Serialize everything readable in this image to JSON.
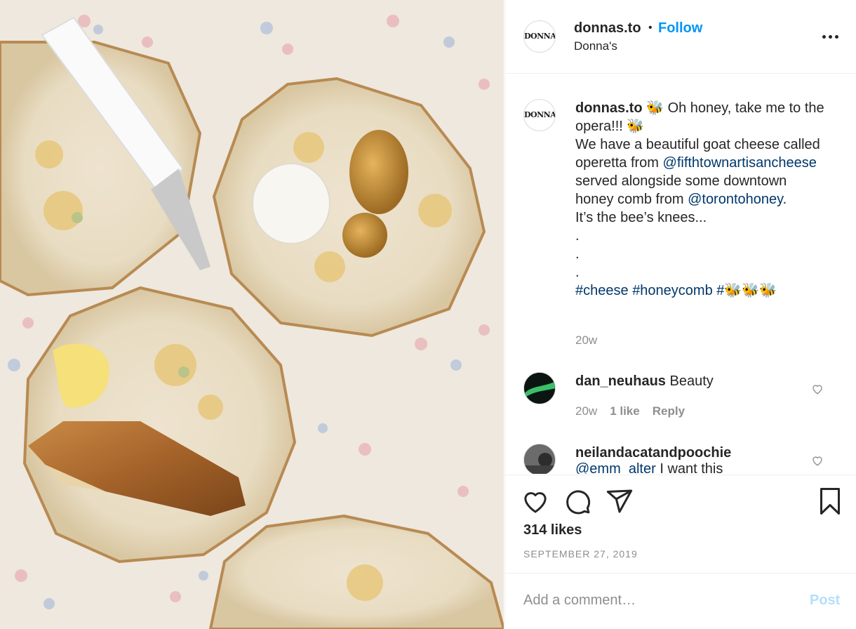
{
  "photo": {
    "description_icon": "food-photo"
  },
  "header": {
    "avatar_text": "DONNA'S",
    "username": "donnas.to",
    "separator": "•",
    "follow_label": "Follow",
    "subtitle": "Donna's",
    "more_icon": "more-options-icon"
  },
  "caption": {
    "username": "donnas.to",
    "line1_a": " 🐝 Oh honey, take me to the opera!!! 🐝",
    "line2": "We have a beautiful goat cheese called operetta from ",
    "mention1": "@fifthtownartisancheese",
    "line3": " served alongside some downtown honey comb from ",
    "mention2": "@torontohoney",
    "line4_end": ".",
    "line5": "It’s the bee’s knees...",
    "dot": ".",
    "hashtag1": "#cheese",
    "hashtag2": "#honeycomb",
    "hashtag3": "#🐝🐝🐝",
    "time": "20w"
  },
  "comments": [
    {
      "username": "dan_neuhaus",
      "text": "Beauty",
      "time": "20w",
      "likes": "1 like",
      "reply": "Reply"
    },
    {
      "username": "neilandacatandpoochie",
      "text": " I want this",
      "mention": "@emm_alter"
    }
  ],
  "actions": {
    "like_icon": "heart-icon",
    "comment_icon": "comment-icon",
    "share_icon": "share-icon",
    "save_icon": "bookmark-icon",
    "likes_text": "314 likes",
    "date": "SEPTEMBER 27, 2019"
  },
  "comment_box": {
    "placeholder": "Add a comment…",
    "post_label": "Post"
  },
  "colors": {
    "link": "#00376b",
    "accent": "#0095f6",
    "post_disabled": "#b2dffc",
    "muted": "#8e8e8e"
  }
}
